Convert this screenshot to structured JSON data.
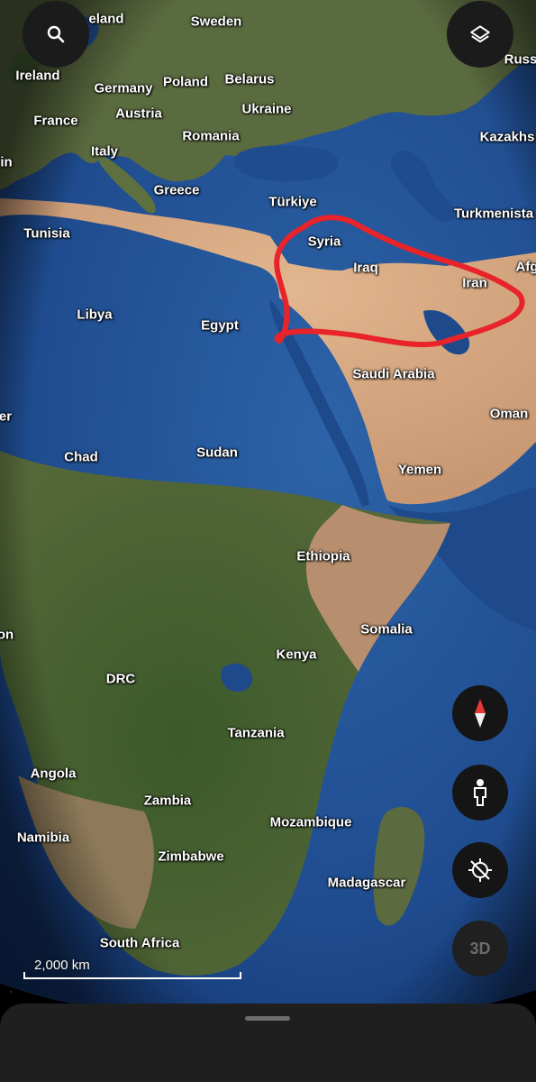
{
  "map": {
    "countries": [
      "Iceland",
      "Sweden",
      "Russia",
      "Ireland",
      "Germany",
      "Poland",
      "Belarus",
      "France",
      "Austria",
      "Ukraine",
      "Kazakhstan",
      "Italy",
      "Romania",
      "Spain",
      "Greece",
      "Türkiye",
      "Turkmenistan",
      "Tunisia",
      "Syria",
      "Afghanistan",
      "Iraq",
      "Iran",
      "Libya",
      "Egypt",
      "Saudi Arabia",
      "Niger",
      "Oman",
      "Chad",
      "Sudan",
      "Yemen",
      "Ethiopia",
      "Somalia",
      "Gabon",
      "Kenya",
      "DRC",
      "Tanzania",
      "Angola",
      "Zambia",
      "Mozambique",
      "Namibia",
      "Zimbabwe",
      "Madagascar",
      "South Africa"
    ],
    "labels": {
      "iceland": "eland",
      "sweden": "Sweden",
      "russia": "Russ",
      "ireland": "Ireland",
      "germany": "Germany",
      "poland": "Poland",
      "belarus": "Belarus",
      "france": "France",
      "austria": "Austria",
      "ukraine": "Ukraine",
      "kazakhstan": "Kazakhs",
      "italy": "Italy",
      "romania": "Romania",
      "spain": "in",
      "greece": "Greece",
      "turkiye": "Türkiye",
      "turkmenistan": "Turkmenista",
      "tunisia": "Tunisia",
      "syria": "Syria",
      "afghanistan": "Afg",
      "iraq": "Iraq",
      "iran": "Iran",
      "libya": "Libya",
      "egypt": "Egypt",
      "saudi_arabia": "Saudi Arabia",
      "niger": "er",
      "oman": "Oman",
      "chad": "Chad",
      "sudan": "Sudan",
      "yemen": "Yemen",
      "ethiopia": "Ethiopia",
      "somalia": "Somalia",
      "gabon": "on",
      "kenya": "Kenya",
      "drc": "DRC",
      "tanzania": "Tanzania",
      "angola": "Angola",
      "zambia": "Zambia",
      "mozambique": "Mozambique",
      "namibia": "Namibia",
      "zimbabwe": "Zimbabwe",
      "madagascar": "Madagascar",
      "south_africa": "South Africa"
    },
    "annotation": {
      "type": "freehand-outline",
      "color": "#e8232a",
      "encloses": [
        "Syria",
        "Iraq",
        "Iran"
      ]
    },
    "colors": {
      "ocean": "#1f4c8f",
      "desert": "#cfa37a",
      "vegetation": "#3f5a2e",
      "space": "#000000"
    }
  },
  "scale_bar": {
    "label": "2,000 km"
  },
  "controls": {
    "search_icon": "search-icon",
    "layers_icon": "layers-icon",
    "compass_icon": "compass-icon",
    "pegman_icon": "pegman-icon",
    "location_icon": "location-off-icon",
    "view_3d_label": "3D"
  },
  "bottom_sheet": {
    "handle": "drag-handle"
  }
}
